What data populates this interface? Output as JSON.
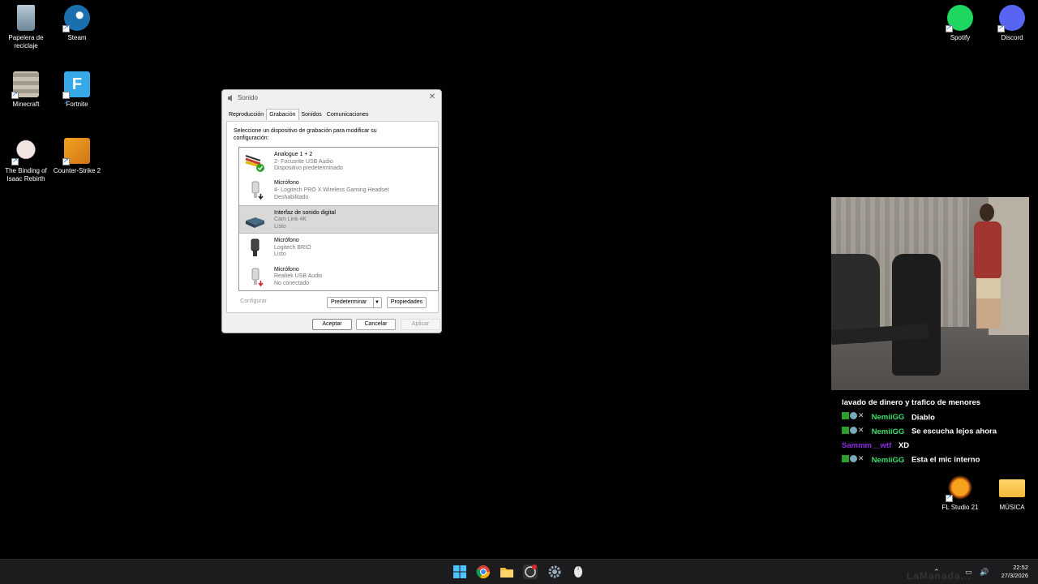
{
  "desktop": {
    "icons_left": [
      {
        "label": "Papelera de reciclaje",
        "icon": "recycle-bin-icon"
      },
      {
        "label": "Steam",
        "icon": "steam-icon"
      },
      {
        "label": "Minecraft",
        "icon": "minecraft-icon"
      },
      {
        "label": "Fortnite",
        "icon": "fortnite-icon"
      },
      {
        "label": "The Binding of Isaac Rebirth",
        "icon": "isaac-icon"
      },
      {
        "label": "Counter-Strike 2",
        "icon": "counter-strike-icon"
      }
    ],
    "icons_right": [
      {
        "label": "Spotify",
        "icon": "spotify-icon"
      },
      {
        "label": "Discord",
        "icon": "discord-icon"
      },
      {
        "label": "FL Studio 21",
        "icon": "fl-studio-icon"
      },
      {
        "label": "MÚSICA",
        "icon": "folder-icon"
      }
    ]
  },
  "dialog": {
    "title": "Sonido",
    "tabs": [
      "Reproducción",
      "Grabación",
      "Sonidos",
      "Comunicaciones"
    ],
    "active_tab": "Grabación",
    "instruction": "Seleccione un dispositivo de grabación para modificar su configuración:",
    "devices": [
      {
        "name": "Analogue 1 + 2",
        "detail": "2- Focusrite USB Audio",
        "status": "Dispositivo predeterminado",
        "icon": "audio-interface-icon",
        "badge": "default-check"
      },
      {
        "name": "Micrófono",
        "detail": "4- Logitech PRO X Wireless Gaming Headset",
        "status": "Deshabilitado",
        "icon": "microphone-icon",
        "badge": "disabled-arrow"
      },
      {
        "name": "Interfaz de sonido digital",
        "detail": "Cam Link 4K",
        "status": "Listo",
        "icon": "capture-card-icon",
        "badge": "none",
        "selected": true
      },
      {
        "name": "Micrófono",
        "detail": "Logitech BRIO",
        "status": "Listo",
        "icon": "microphone-icon",
        "badge": "none"
      },
      {
        "name": "Micrófono",
        "detail": "Realtek USB Audio",
        "status": "No conectado",
        "icon": "microphone-icon",
        "badge": "disconnected-arrow"
      }
    ],
    "buttons": {
      "configure": "Configurar",
      "set_default": "Predeterminar",
      "properties": "Propiedades",
      "ok": "Aceptar",
      "cancel": "Cancelar",
      "apply": "Aplicar"
    }
  },
  "chat": {
    "messages": [
      {
        "user": "",
        "text": "lavado de dinero y trafico de menores",
        "badges": false
      },
      {
        "user": "NemiiGG",
        "text": "Diablo",
        "badges": true,
        "color": "#3ddc6a"
      },
      {
        "user": "NemiiGG",
        "text": "Se escucha lejos ahora",
        "badges": true,
        "color": "#3ddc6a"
      },
      {
        "user": "Sammm__wtf",
        "text": "XD",
        "badges": false,
        "color": "#8a2be2"
      },
      {
        "user": "NemiiGG",
        "text": "Esta el mic interno",
        "badges": true,
        "color": "#3ddc6a"
      }
    ]
  },
  "taskbar": {
    "apps": [
      "windows-start-icon",
      "chrome-icon",
      "file-explorer-icon",
      "obs-icon",
      "settings-icon",
      "mouse-app-icon"
    ],
    "time": "22:52",
    "date": "27/3/2026"
  },
  "watermark": "LaManada..."
}
